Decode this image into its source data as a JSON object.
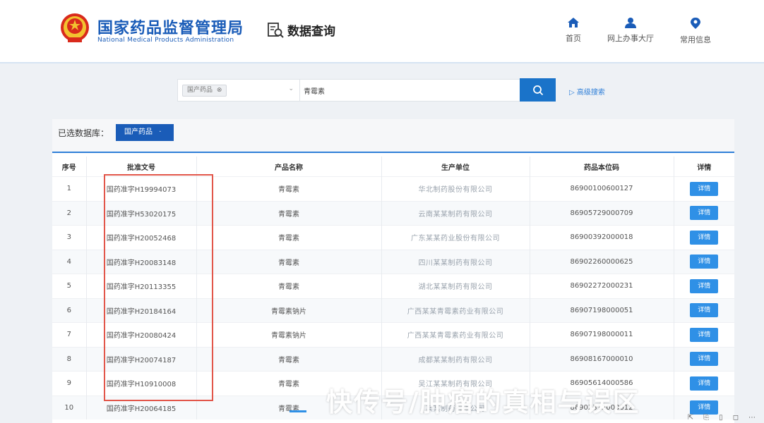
{
  "header": {
    "title_cn": "国家药品监督管理局",
    "title_en": "National Medical Products Administration",
    "data_query": "数据查询",
    "nav": [
      {
        "label": "首页",
        "icon": "home-icon"
      },
      {
        "label": "网上办事大厅",
        "icon": "user-icon"
      },
      {
        "label": "常用信息",
        "icon": "location-pin-icon"
      }
    ]
  },
  "search": {
    "category_tag": "国产药品",
    "query": "青霉素",
    "advanced": "高级搜索"
  },
  "filter": {
    "label": "已选数据库：",
    "chip": "国产药品"
  },
  "table": {
    "headers": [
      "序号",
      "批准文号",
      "产品名称",
      "生产单位",
      "药品本位码",
      "详情"
    ],
    "detail_label": "详情",
    "rows": [
      {
        "no": "1",
        "approval": "国药准字H19994073",
        "product": "青霉素",
        "maker": "华北制药股份有限公司",
        "code": "86900100600127"
      },
      {
        "no": "2",
        "approval": "国药准字H53020175",
        "product": "青霉素",
        "maker": "云南某某制药有限公司",
        "code": "86905729000709"
      },
      {
        "no": "3",
        "approval": "国药准字H20052468",
        "product": "青霉素",
        "maker": "广东某某药业股份有限公司",
        "code": "86900392000018"
      },
      {
        "no": "4",
        "approval": "国药准字H20083148",
        "product": "青霉素",
        "maker": "四川某某制药有限公司",
        "code": "86902260000625"
      },
      {
        "no": "5",
        "approval": "国药准字H20113355",
        "product": "青霉素",
        "maker": "湖北某某制药有限公司",
        "code": "86902272000231"
      },
      {
        "no": "6",
        "approval": "国药准字H20184164",
        "product": "青霉素钠片",
        "maker": "广西某某青霉素药业有限公司",
        "code": "86907198000051"
      },
      {
        "no": "7",
        "approval": "国药准字H20080424",
        "product": "青霉素钠片",
        "maker": "广西某某青霉素药业有限公司",
        "code": "86907198000011"
      },
      {
        "no": "8",
        "approval": "国药准字H20074187",
        "product": "青霉素",
        "maker": "成都某某制药有限公司",
        "code": "86908167000010"
      },
      {
        "no": "9",
        "approval": "国药准字H10910008",
        "product": "青霉素",
        "maker": "吴江某某制药有限公司",
        "code": "86905614000586"
      },
      {
        "no": "10",
        "approval": "国药准字H20064185",
        "product": "青霉素",
        "maker": "某某制药有限公司",
        "code": "86902312000012"
      }
    ]
  },
  "watermark": "快传号/肿瘤的真相与误区",
  "colors": {
    "brand_blue": "#1a5cb8",
    "button_blue": "#1a73c9",
    "detail_blue": "#2f90e6",
    "highlight_red": "#e2564a"
  }
}
